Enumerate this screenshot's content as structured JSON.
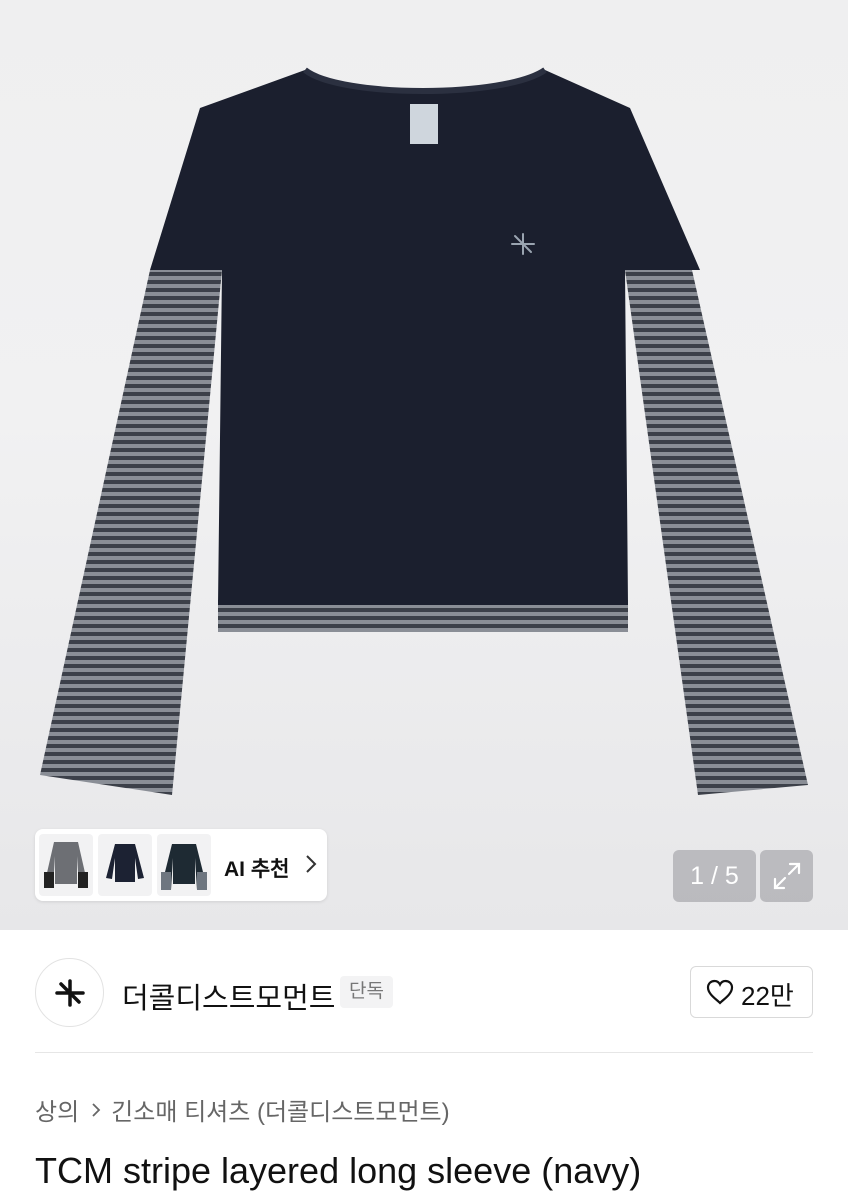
{
  "gallery": {
    "current_page": "1",
    "separator": "/",
    "total_pages": "5",
    "counter_text": "1 / 5"
  },
  "ai_recommend": {
    "label": "AI 추천",
    "thumbnails": [
      "gray-sweater-thumb",
      "navy-top-thumb",
      "dark-sweatshirt-thumb"
    ]
  },
  "brand": {
    "name": "더콜디스트모먼트",
    "badge": "단독",
    "likes": "22만"
  },
  "breadcrumb": {
    "category": "상의",
    "subcategory": "긴소매 티셔츠 (더콜디스트모먼트)"
  },
  "product": {
    "title": "TCM stripe layered long sleeve (navy)"
  },
  "colors": {
    "navy": "#1b1f2e",
    "stripe_light": "#8a8e96",
    "stripe_dark": "#3c4049"
  }
}
